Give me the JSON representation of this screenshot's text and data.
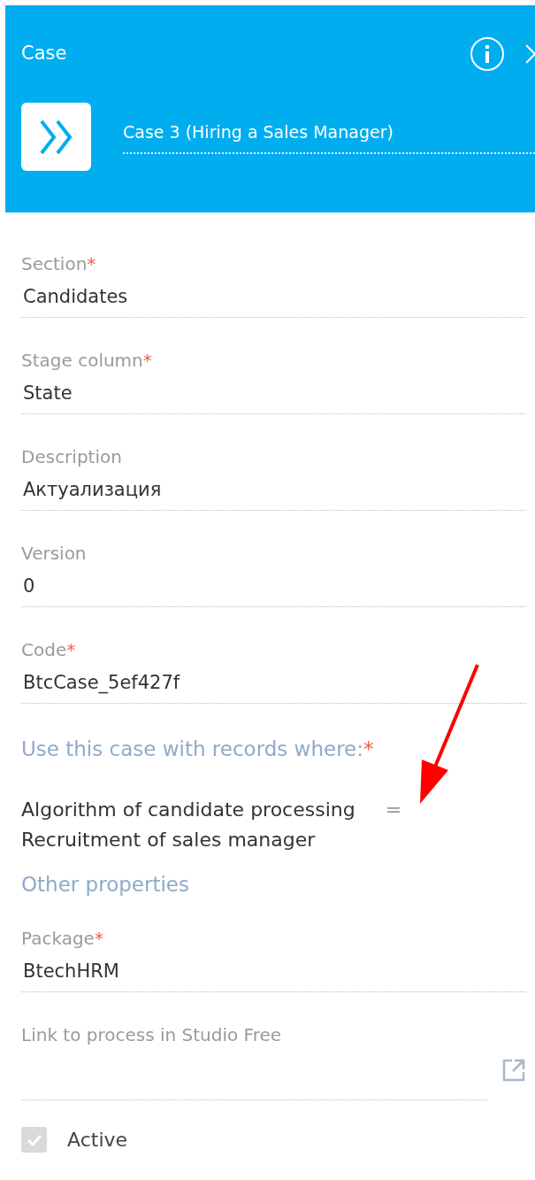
{
  "header": {
    "title": "Case",
    "name": "Case 3 (Hiring a Sales Manager)"
  },
  "fields": [
    {
      "label": "Section",
      "required_mark": "*",
      "value": "Candidates"
    },
    {
      "label": "Stage column",
      "required_mark": "*",
      "value": "State"
    },
    {
      "label": "Description",
      "value": "Актуализация"
    },
    {
      "label": "Version",
      "value": "0"
    },
    {
      "label": "Code",
      "required_mark": "*",
      "value": "BtcCase_5ef427f"
    }
  ],
  "condition": {
    "heading": "Use this case with records where:",
    "required_mark": "*",
    "column": "Algorithm of candidate processing",
    "operator": "=",
    "value": "Recruitment of sales manager"
  },
  "other": {
    "heading": "Other properties",
    "fields": [
      {
        "label": "Package",
        "required_mark": "*",
        "value": "BtechHRM"
      }
    ],
    "link": {
      "label": "Link to process in Studio Free"
    },
    "active": {
      "label": "Active",
      "checked": true,
      "disabled": true
    }
  }
}
